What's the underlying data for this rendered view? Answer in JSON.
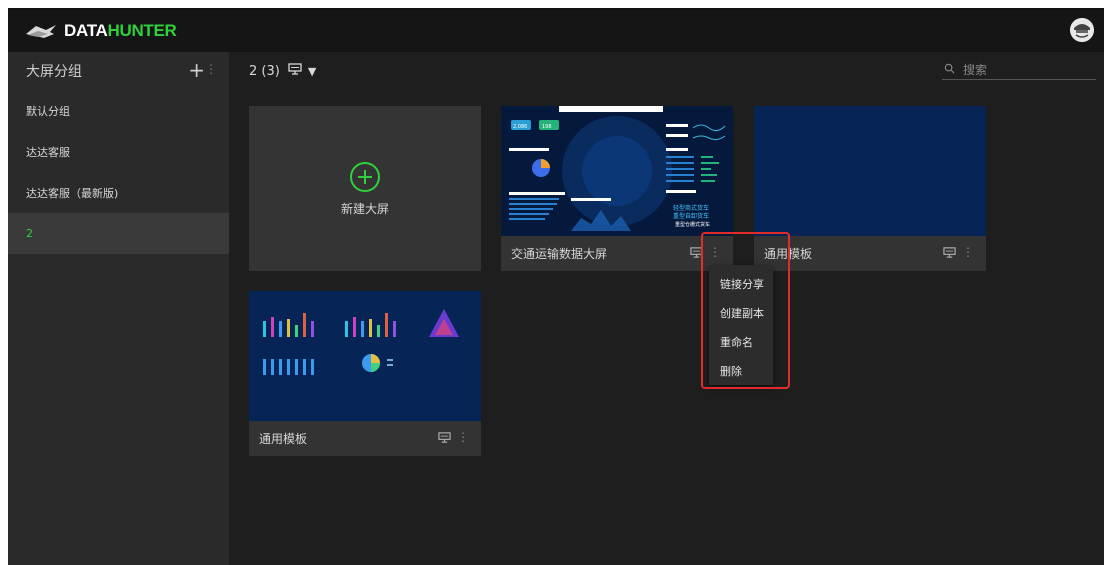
{
  "brand": {
    "part1": "DATA",
    "part2": "HUNTER"
  },
  "sidebar": {
    "title": "大屏分组",
    "add_label": "+",
    "more_label": "⋮",
    "items": [
      {
        "label": "默认分组",
        "active": false
      },
      {
        "label": "达达客服",
        "active": false
      },
      {
        "label": "达达客服（最新版)",
        "active": false
      },
      {
        "label": "2",
        "active": true
      }
    ]
  },
  "main": {
    "group_title": "2 (3)",
    "dropdown_caret": "▼",
    "search_placeholder": "搜索",
    "new_screen_label": "新建大屏",
    "cards": [
      {
        "title": "交通运输数据大屏"
      },
      {
        "title": "通用模板"
      },
      {
        "title": "通用模板"
      }
    ],
    "context_menu": [
      "链接分享",
      "创建副本",
      "重命名",
      "删除"
    ]
  },
  "thumb_text": {
    "t1": "轻型商式货车",
    "t2": "重型自卸货车",
    "t3": "重型仓栅式货车",
    "n1": "2,086",
    "n2": "198"
  },
  "colors": {
    "accent": "#2fd03c",
    "background": "#1e1e1e",
    "sidebar": "#2a2a2a",
    "card": "#333333",
    "highlight_box": "#e22b2b"
  },
  "icons": {
    "monitor": "monitor-icon",
    "more": "more-vertical-icon",
    "search": "search-icon",
    "add": "plus-icon"
  }
}
